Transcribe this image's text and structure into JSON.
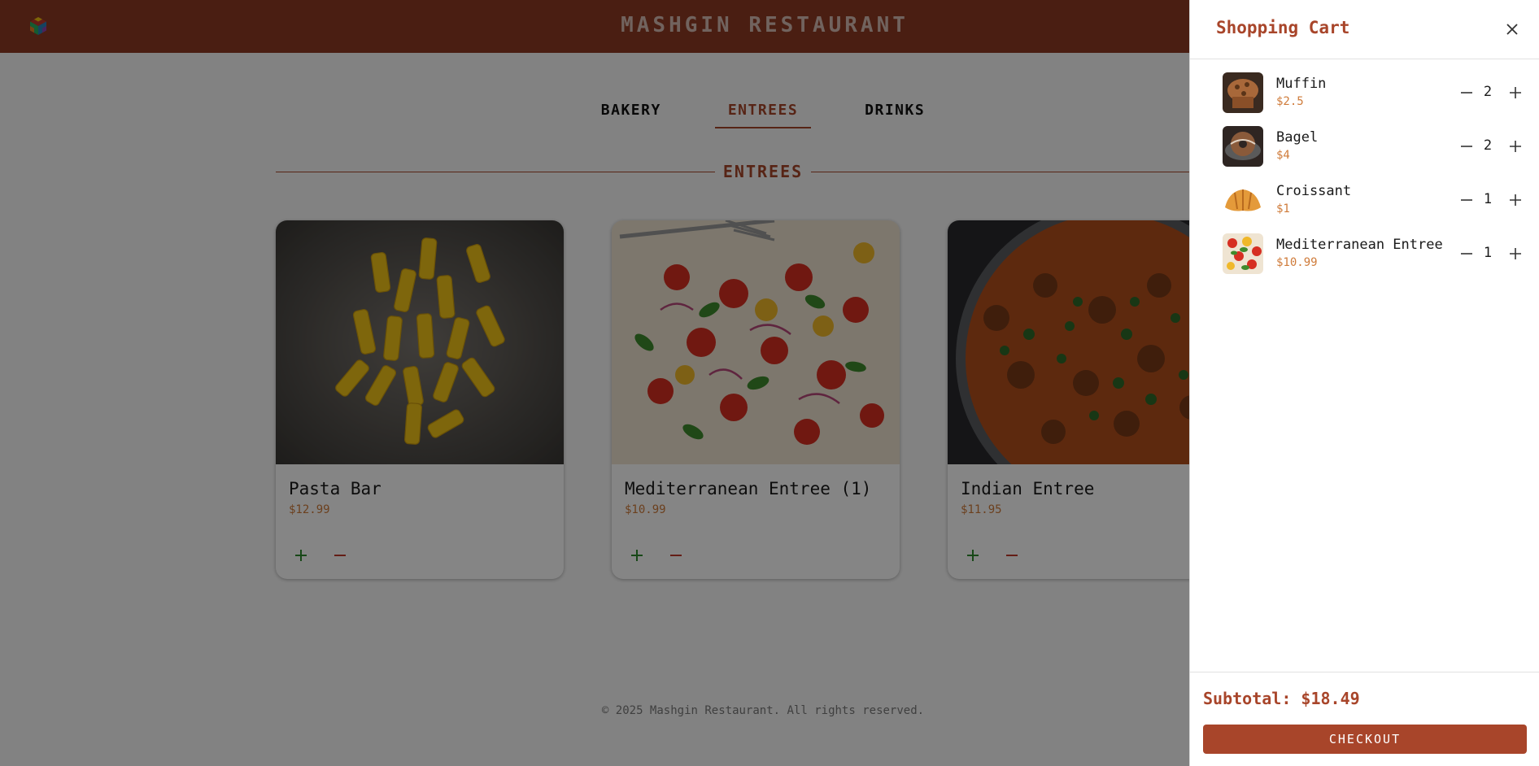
{
  "header": {
    "brand": "MASHGIN RESTAURANT",
    "logo_icon": "cube-logo-icon"
  },
  "tabs": [
    {
      "label": "BAKERY",
      "active": false
    },
    {
      "label": "ENTREES",
      "active": true
    },
    {
      "label": "DRINKS",
      "active": false
    }
  ],
  "section": {
    "title": "ENTREES"
  },
  "menu_items": [
    {
      "name": "Pasta Bar",
      "price": "$12.99",
      "image": "rigatoni pasta on dark stone"
    },
    {
      "name": "Mediterranean Entree (1)",
      "price": "$10.99",
      "image": "tomato basil salad"
    },
    {
      "name": "Indian Entree",
      "price": "$11.95",
      "image": "curry in pan with herbs"
    }
  ],
  "footer": {
    "text": "© 2025 Mashgin Restaurant. All rights reserved."
  },
  "cart": {
    "title": "Shopping Cart",
    "items": [
      {
        "name": "Muffin",
        "price": "$2.5",
        "qty": "2"
      },
      {
        "name": "Bagel",
        "price": "$4",
        "qty": "2"
      },
      {
        "name": "Croissant",
        "price": "$1",
        "qty": "1"
      },
      {
        "name": "Mediterranean Entree",
        "price": "$10.99",
        "qty": "1"
      }
    ],
    "subtotal": "Subtotal: $18.49",
    "checkout_label": "CHECKOUT"
  },
  "colors": {
    "header_bg": "#8f3a24",
    "accent": "#a8452a",
    "price": "#cf7b3a",
    "add_icon": "#2e8b2e",
    "remove_icon": "#c0392b"
  }
}
